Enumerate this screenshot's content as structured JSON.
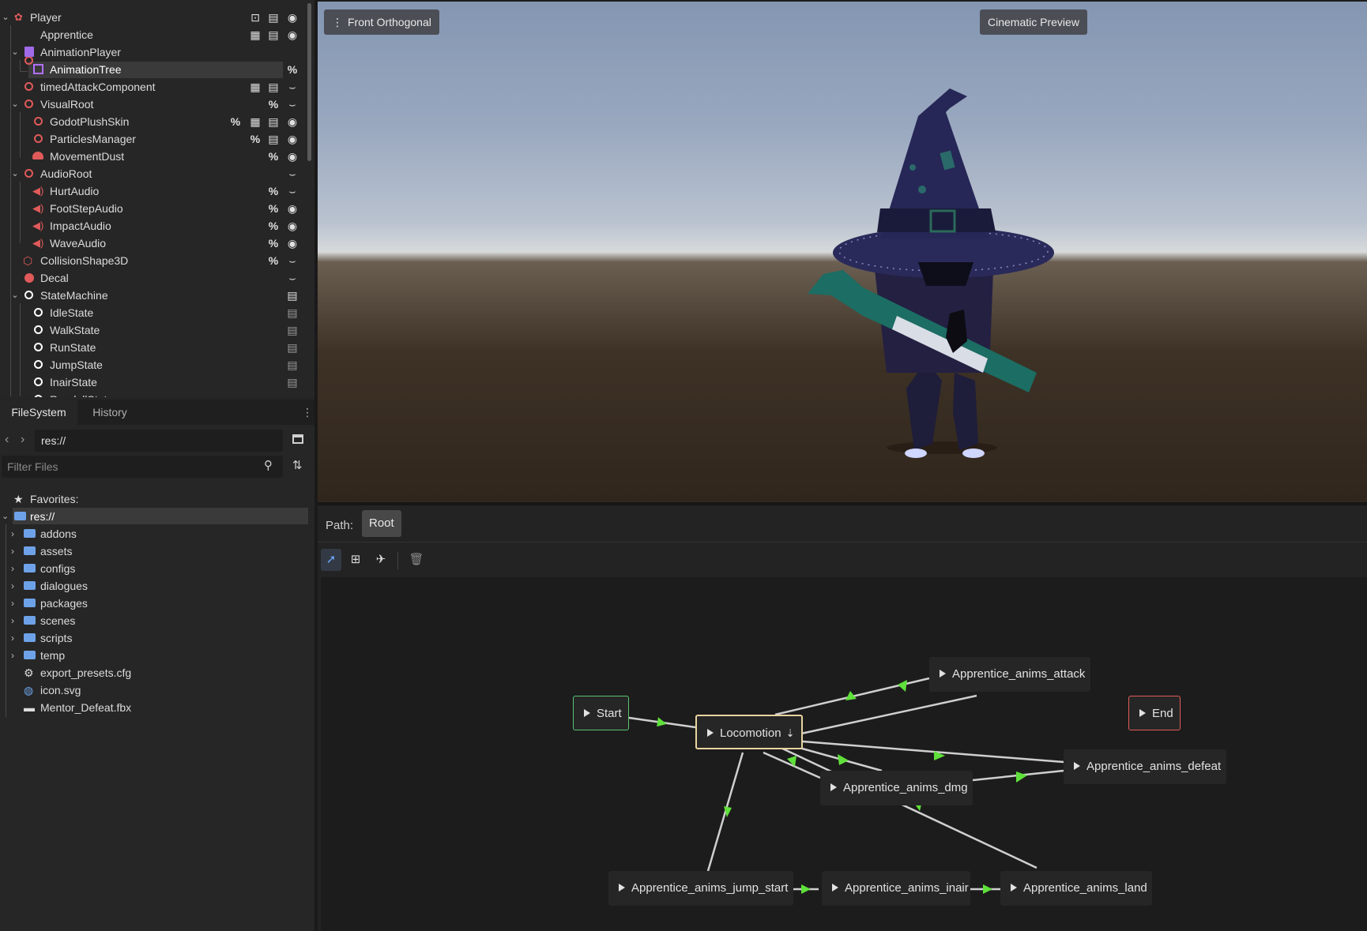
{
  "scene_tree": {
    "nodes": [
      {
        "label": "Player",
        "icon": "player-node-icon",
        "color": "#e05a5a"
      },
      {
        "label": "Apprentice",
        "icon": "node3d-icon",
        "color": "#e05a5a"
      },
      {
        "label": "AnimationPlayer",
        "icon": "animation-player-icon",
        "color": "#b070ff"
      },
      {
        "label": "AnimationTree",
        "icon": "animation-tree-icon",
        "color": "#b070ff"
      },
      {
        "label": "timedAttackComponent",
        "icon": "node3d-icon",
        "color": "#e05a5a"
      },
      {
        "label": "VisualRoot",
        "icon": "node3d-icon",
        "color": "#e05a5a"
      },
      {
        "label": "GodotPlushSkin",
        "icon": "node3d-icon",
        "color": "#e05a5a"
      },
      {
        "label": "ParticlesManager",
        "icon": "node3d-icon",
        "color": "#e05a5a"
      },
      {
        "label": "MovementDust",
        "icon": "particles-icon",
        "color": "#e05a5a"
      },
      {
        "label": "AudioRoot",
        "icon": "node3d-icon",
        "color": "#e05a5a"
      },
      {
        "label": "HurtAudio",
        "icon": "audio-icon",
        "color": "#e05a5a"
      },
      {
        "label": "FootStepAudio",
        "icon": "audio-icon",
        "color": "#e05a5a"
      },
      {
        "label": "ImpactAudio",
        "icon": "audio-icon",
        "color": "#e05a5a"
      },
      {
        "label": "WaveAudio",
        "icon": "audio-icon",
        "color": "#e05a5a"
      },
      {
        "label": "CollisionShape3D",
        "icon": "collision-shape-icon",
        "color": "#e05a5a"
      },
      {
        "label": "Decal",
        "icon": "decal-icon",
        "color": "#e05a5a"
      },
      {
        "label": "StateMachine",
        "icon": "node-icon",
        "color": "#ffffff"
      },
      {
        "label": "IdleState",
        "icon": "node-icon",
        "color": "#ffffff"
      },
      {
        "label": "WalkState",
        "icon": "node-icon",
        "color": "#ffffff"
      },
      {
        "label": "RunState",
        "icon": "node-icon",
        "color": "#ffffff"
      },
      {
        "label": "JumpState",
        "icon": "node-icon",
        "color": "#ffffff"
      },
      {
        "label": "InairState",
        "icon": "node-icon",
        "color": "#ffffff"
      },
      {
        "label": "RagdollState",
        "icon": "node-icon",
        "color": "#ffffff"
      }
    ],
    "unique_name_symbol": "%"
  },
  "filesystem": {
    "tabs": [
      "FileSystem",
      "History"
    ],
    "path": "res://",
    "filter_placeholder": "Filter Files",
    "favorites_label": "Favorites:",
    "root_label": "res://",
    "folders": [
      "addons",
      "assets",
      "configs",
      "dialogues",
      "packages",
      "scenes",
      "scripts",
      "temp"
    ],
    "files": [
      {
        "label": "export_presets.cfg",
        "icon": "gear-file-icon"
      },
      {
        "label": "icon.svg",
        "icon": "godot-svg-icon"
      },
      {
        "label": "Mentor_Defeat.fbx",
        "icon": "scene-file-icon"
      }
    ]
  },
  "viewport": {
    "view_menu_label": "Front Orthogonal",
    "preview_label": "Cinematic Preview"
  },
  "animation_tree": {
    "path_label": "Path:",
    "path_root": "Root",
    "nodes": {
      "start": "Start",
      "end": "End",
      "locomotion": "Locomotion",
      "attack": "Apprentice_anims_attack",
      "defeat": "Apprentice_anims_defeat",
      "dmg": "Apprentice_anims_dmg",
      "jump_start": "Apprentice_anims_jump_start",
      "inair": "Apprentice_anims_inair",
      "land": "Apprentice_anims_land"
    },
    "colors": {
      "start_border": "#58c472",
      "end_border": "#e25a5a",
      "selected_border": "#e8d4a0",
      "transition_arrow": "#5fe03a"
    }
  }
}
